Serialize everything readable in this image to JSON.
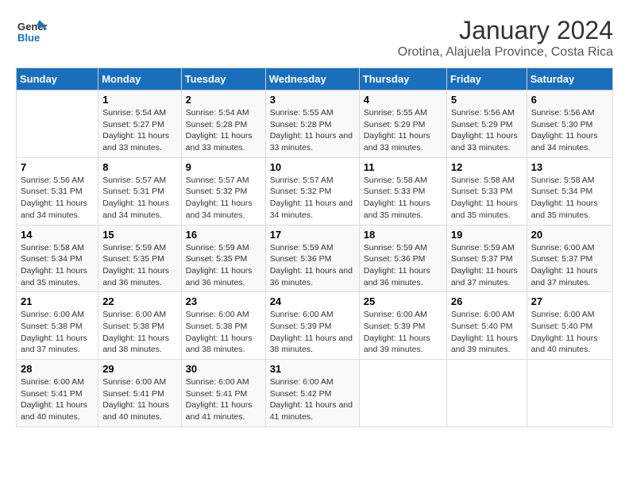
{
  "logo": {
    "line1": "General",
    "line2": "Blue"
  },
  "title": "January 2024",
  "subtitle": "Orotina, Alajuela Province, Costa Rica",
  "days_of_week": [
    "Sunday",
    "Monday",
    "Tuesday",
    "Wednesday",
    "Thursday",
    "Friday",
    "Saturday"
  ],
  "weeks": [
    [
      {
        "num": "",
        "sunrise": "",
        "sunset": "",
        "daylight": ""
      },
      {
        "num": "1",
        "sunrise": "Sunrise: 5:54 AM",
        "sunset": "Sunset: 5:27 PM",
        "daylight": "Daylight: 11 hours and 33 minutes."
      },
      {
        "num": "2",
        "sunrise": "Sunrise: 5:54 AM",
        "sunset": "Sunset: 5:28 PM",
        "daylight": "Daylight: 11 hours and 33 minutes."
      },
      {
        "num": "3",
        "sunrise": "Sunrise: 5:55 AM",
        "sunset": "Sunset: 5:28 PM",
        "daylight": "Daylight: 11 hours and 33 minutes."
      },
      {
        "num": "4",
        "sunrise": "Sunrise: 5:55 AM",
        "sunset": "Sunset: 5:29 PM",
        "daylight": "Daylight: 11 hours and 33 minutes."
      },
      {
        "num": "5",
        "sunrise": "Sunrise: 5:56 AM",
        "sunset": "Sunset: 5:29 PM",
        "daylight": "Daylight: 11 hours and 33 minutes."
      },
      {
        "num": "6",
        "sunrise": "Sunrise: 5:56 AM",
        "sunset": "Sunset: 5:30 PM",
        "daylight": "Daylight: 11 hours and 34 minutes."
      }
    ],
    [
      {
        "num": "7",
        "sunrise": "Sunrise: 5:56 AM",
        "sunset": "Sunset: 5:31 PM",
        "daylight": "Daylight: 11 hours and 34 minutes."
      },
      {
        "num": "8",
        "sunrise": "Sunrise: 5:57 AM",
        "sunset": "Sunset: 5:31 PM",
        "daylight": "Daylight: 11 hours and 34 minutes."
      },
      {
        "num": "9",
        "sunrise": "Sunrise: 5:57 AM",
        "sunset": "Sunset: 5:32 PM",
        "daylight": "Daylight: 11 hours and 34 minutes."
      },
      {
        "num": "10",
        "sunrise": "Sunrise: 5:57 AM",
        "sunset": "Sunset: 5:32 PM",
        "daylight": "Daylight: 11 hours and 34 minutes."
      },
      {
        "num": "11",
        "sunrise": "Sunrise: 5:58 AM",
        "sunset": "Sunset: 5:33 PM",
        "daylight": "Daylight: 11 hours and 35 minutes."
      },
      {
        "num": "12",
        "sunrise": "Sunrise: 5:58 AM",
        "sunset": "Sunset: 5:33 PM",
        "daylight": "Daylight: 11 hours and 35 minutes."
      },
      {
        "num": "13",
        "sunrise": "Sunrise: 5:58 AM",
        "sunset": "Sunset: 5:34 PM",
        "daylight": "Daylight: 11 hours and 35 minutes."
      }
    ],
    [
      {
        "num": "14",
        "sunrise": "Sunrise: 5:58 AM",
        "sunset": "Sunset: 5:34 PM",
        "daylight": "Daylight: 11 hours and 35 minutes."
      },
      {
        "num": "15",
        "sunrise": "Sunrise: 5:59 AM",
        "sunset": "Sunset: 5:35 PM",
        "daylight": "Daylight: 11 hours and 36 minutes."
      },
      {
        "num": "16",
        "sunrise": "Sunrise: 5:59 AM",
        "sunset": "Sunset: 5:35 PM",
        "daylight": "Daylight: 11 hours and 36 minutes."
      },
      {
        "num": "17",
        "sunrise": "Sunrise: 5:59 AM",
        "sunset": "Sunset: 5:36 PM",
        "daylight": "Daylight: 11 hours and 36 minutes."
      },
      {
        "num": "18",
        "sunrise": "Sunrise: 5:59 AM",
        "sunset": "Sunset: 5:36 PM",
        "daylight": "Daylight: 11 hours and 36 minutes."
      },
      {
        "num": "19",
        "sunrise": "Sunrise: 5:59 AM",
        "sunset": "Sunset: 5:37 PM",
        "daylight": "Daylight: 11 hours and 37 minutes."
      },
      {
        "num": "20",
        "sunrise": "Sunrise: 6:00 AM",
        "sunset": "Sunset: 5:37 PM",
        "daylight": "Daylight: 11 hours and 37 minutes."
      }
    ],
    [
      {
        "num": "21",
        "sunrise": "Sunrise: 6:00 AM",
        "sunset": "Sunset: 5:38 PM",
        "daylight": "Daylight: 11 hours and 37 minutes."
      },
      {
        "num": "22",
        "sunrise": "Sunrise: 6:00 AM",
        "sunset": "Sunset: 5:38 PM",
        "daylight": "Daylight: 11 hours and 38 minutes."
      },
      {
        "num": "23",
        "sunrise": "Sunrise: 6:00 AM",
        "sunset": "Sunset: 5:38 PM",
        "daylight": "Daylight: 11 hours and 38 minutes."
      },
      {
        "num": "24",
        "sunrise": "Sunrise: 6:00 AM",
        "sunset": "Sunset: 5:39 PM",
        "daylight": "Daylight: 11 hours and 38 minutes."
      },
      {
        "num": "25",
        "sunrise": "Sunrise: 6:00 AM",
        "sunset": "Sunset: 5:39 PM",
        "daylight": "Daylight: 11 hours and 39 minutes."
      },
      {
        "num": "26",
        "sunrise": "Sunrise: 6:00 AM",
        "sunset": "Sunset: 5:40 PM",
        "daylight": "Daylight: 11 hours and 39 minutes."
      },
      {
        "num": "27",
        "sunrise": "Sunrise: 6:00 AM",
        "sunset": "Sunset: 5:40 PM",
        "daylight": "Daylight: 11 hours and 40 minutes."
      }
    ],
    [
      {
        "num": "28",
        "sunrise": "Sunrise: 6:00 AM",
        "sunset": "Sunset: 5:41 PM",
        "daylight": "Daylight: 11 hours and 40 minutes."
      },
      {
        "num": "29",
        "sunrise": "Sunrise: 6:00 AM",
        "sunset": "Sunset: 5:41 PM",
        "daylight": "Daylight: 11 hours and 40 minutes."
      },
      {
        "num": "30",
        "sunrise": "Sunrise: 6:00 AM",
        "sunset": "Sunset: 5:41 PM",
        "daylight": "Daylight: 11 hours and 41 minutes."
      },
      {
        "num": "31",
        "sunrise": "Sunrise: 6:00 AM",
        "sunset": "Sunset: 5:42 PM",
        "daylight": "Daylight: 11 hours and 41 minutes."
      },
      {
        "num": "",
        "sunrise": "",
        "sunset": "",
        "daylight": ""
      },
      {
        "num": "",
        "sunrise": "",
        "sunset": "",
        "daylight": ""
      },
      {
        "num": "",
        "sunrise": "",
        "sunset": "",
        "daylight": ""
      }
    ]
  ]
}
